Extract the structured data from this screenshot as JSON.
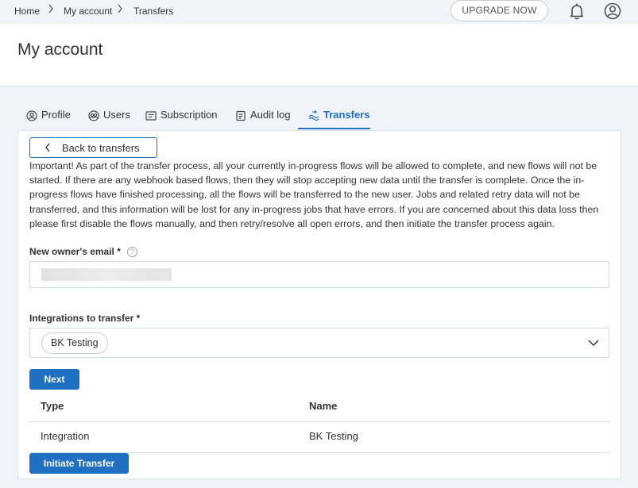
{
  "breadcrumb": {
    "items": [
      "Home",
      "My account",
      "Transfers"
    ]
  },
  "topbar": {
    "upgrade_label": "UPGRADE NOW",
    "icons": [
      "bell-icon",
      "account-icon"
    ]
  },
  "page": {
    "title": "My account"
  },
  "tabs": [
    {
      "label": "Profile",
      "icon": "profile-icon",
      "active": false
    },
    {
      "label": "Users",
      "icon": "users-icon",
      "active": false
    },
    {
      "label": "Subscription",
      "icon": "subscription-icon",
      "active": false
    },
    {
      "label": "Audit log",
      "icon": "audit-log-icon",
      "active": false
    },
    {
      "label": "Transfers",
      "icon": "transfers-icon",
      "active": true
    }
  ],
  "transfer": {
    "back_label": "Back to transfers",
    "notice": "Important! As part of the transfer process, all your currently in-progress flows will be allowed to complete, and new flows will not be started. If there are any webhook based flows, then they will stop accepting new data until the transfer is complete. Once the in-progress flows have finished processing, all the flows will be transferred to the new user. Jobs and related retry data will not be transferred, and this information will be lost for any in-progress jobs that have errors. If you are concerned about this data loss then please first disable the flows manually, and then retry/resolve all open errors, and then initiate the transfer process again.",
    "email_label": "New owner's email *",
    "help_glyph": "?",
    "integrations_label": "Integrations to transfer *",
    "selected_integration": "BK Testing",
    "next_label": "Next",
    "table": {
      "headers": [
        "Type",
        "Name"
      ],
      "rows": [
        [
          "Integration",
          "BK Testing"
        ]
      ]
    },
    "initiate_label": "Initiate Transfer"
  },
  "colors": {
    "accent": "#1f70c1",
    "page_bg": "#f0f4f8",
    "border": "#dce3ea"
  }
}
